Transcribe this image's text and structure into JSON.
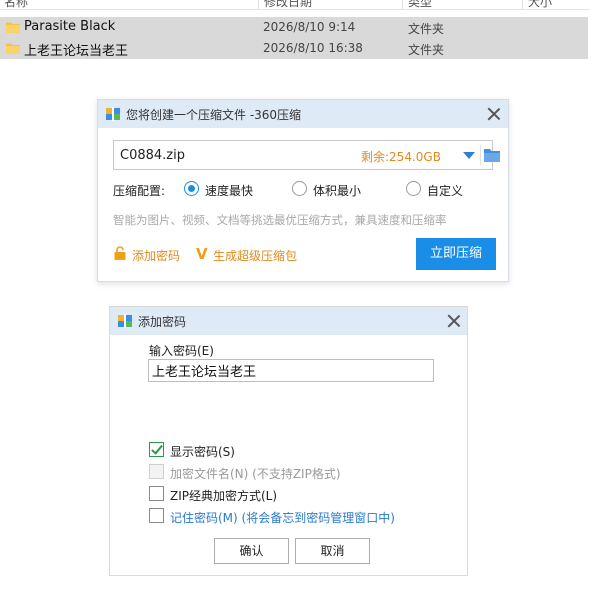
{
  "explorer": {
    "columns": [
      "名称",
      "修改日期",
      "类型",
      "大小"
    ],
    "files": [
      {
        "name": "Parasite Black",
        "date": "2026/8/10 9:14",
        "type": "文件夹"
      },
      {
        "name": "上老王论坛当老王",
        "date": "2026/8/10 16:38",
        "type": "文件夹"
      }
    ]
  },
  "zip_dialog": {
    "title": "您将创建一个压缩文件 -360压缩",
    "file_name": "C0884.zip",
    "free_space": "剩余:254.0GB",
    "config_label": "压缩配置:",
    "options": [
      {
        "label": "速度最快",
        "checked": true
      },
      {
        "label": "体积最小",
        "checked": false
      },
      {
        "label": "自定义",
        "checked": false
      }
    ],
    "hint": "智能为图片、视频、文档等挑选最优压缩方式，兼具速度和压缩率",
    "add_password": "添加密码",
    "super_pack": "生成超级压缩包",
    "compress_button": "立即压缩"
  },
  "password_dialog": {
    "title": "添加密码",
    "input_label": "输入密码(E)",
    "password_value": "上老王论坛当老王",
    "options": [
      {
        "label": "显示密码(S)",
        "checked": true,
        "disabled": false
      },
      {
        "label": "加密文件名(N) (不支持ZIP格式)",
        "checked": false,
        "disabled": true
      },
      {
        "label": "ZIP经典加密方式(L)",
        "checked": false,
        "disabled": false
      },
      {
        "label": "记住密码(M) (将会备忘到密码管理窗口中)",
        "checked": false,
        "disabled": false
      }
    ],
    "ok_button": "确认",
    "cancel_button": "取消"
  }
}
